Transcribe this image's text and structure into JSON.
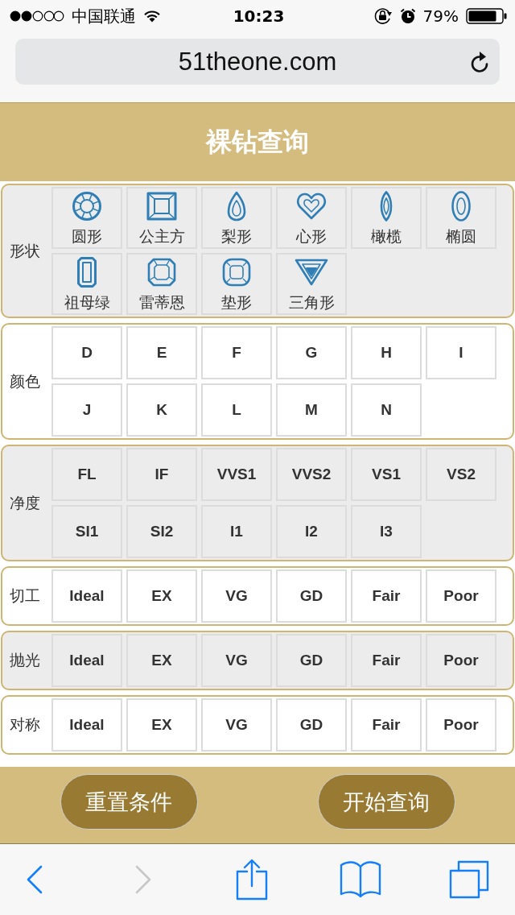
{
  "status_bar": {
    "carrier": "中国联通",
    "time": "10:23",
    "battery": "79%"
  },
  "address_bar": {
    "url": "51theone.com"
  },
  "header": {
    "title": "裸钻查询"
  },
  "filters": [
    {
      "label": "形状",
      "kind": "shape",
      "options": [
        {
          "label": "圆形",
          "kind": "round",
          "selected": false
        },
        {
          "label": "公主方",
          "kind": "square",
          "selected": false
        },
        {
          "label": "梨形",
          "kind": "pear",
          "selected": false
        },
        {
          "label": "心形",
          "kind": "heart",
          "selected": false
        },
        {
          "label": "橄榄",
          "kind": "marquise",
          "selected": false
        },
        {
          "label": "椭圆",
          "kind": "oval",
          "selected": false
        },
        {
          "label": "祖母绿",
          "kind": "emerald",
          "selected": false
        },
        {
          "label": "雷蒂恩",
          "kind": "radiant",
          "selected": false
        },
        {
          "label": "垫形",
          "kind": "cushion",
          "selected": false
        },
        {
          "label": "三角形",
          "kind": "triangle",
          "selected": false
        }
      ]
    },
    {
      "label": "颜色",
      "kind": "grade",
      "options": [
        {
          "label": "D",
          "selected": false
        },
        {
          "label": "E",
          "selected": false
        },
        {
          "label": "F",
          "selected": false
        },
        {
          "label": "G",
          "selected": false
        },
        {
          "label": "H",
          "selected": false
        },
        {
          "label": "I",
          "selected": false
        },
        {
          "label": "J",
          "selected": false
        },
        {
          "label": "K",
          "selected": false
        },
        {
          "label": "L",
          "selected": false
        },
        {
          "label": "M",
          "selected": false
        },
        {
          "label": "N",
          "selected": false
        }
      ]
    },
    {
      "label": "净度",
      "kind": "grade",
      "options": [
        {
          "label": "FL",
          "selected": false
        },
        {
          "label": "IF",
          "selected": false
        },
        {
          "label": "VVS1",
          "selected": false
        },
        {
          "label": "VVS2",
          "selected": false
        },
        {
          "label": "VS1",
          "selected": false
        },
        {
          "label": "VS2",
          "selected": false
        },
        {
          "label": "SI1",
          "selected": false
        },
        {
          "label": "SI2",
          "selected": false
        },
        {
          "label": "I1",
          "selected": false
        },
        {
          "label": "I2",
          "selected": false
        },
        {
          "label": "I3",
          "selected": false
        }
      ]
    },
    {
      "label": "切工",
      "kind": "grade",
      "options": [
        {
          "label": "Ideal",
          "selected": false
        },
        {
          "label": "EX",
          "selected": false
        },
        {
          "label": "VG",
          "selected": false
        },
        {
          "label": "GD",
          "selected": false
        },
        {
          "label": "Fair",
          "selected": false
        },
        {
          "label": "Poor",
          "selected": false
        }
      ]
    },
    {
      "label": "抛光",
      "kind": "grade",
      "options": [
        {
          "label": "Ideal",
          "selected": false
        },
        {
          "label": "EX",
          "selected": false
        },
        {
          "label": "VG",
          "selected": false
        },
        {
          "label": "GD",
          "selected": false
        },
        {
          "label": "Fair",
          "selected": false
        },
        {
          "label": "Poor",
          "selected": false
        }
      ]
    },
    {
      "label": "对称",
      "kind": "grade",
      "options": [
        {
          "label": "Ideal",
          "selected": false
        },
        {
          "label": "EX",
          "selected": false
        },
        {
          "label": "VG",
          "selected": false
        },
        {
          "label": "GD",
          "selected": false
        },
        {
          "label": "Fair",
          "selected": false
        },
        {
          "label": "Poor",
          "selected": false
        }
      ]
    }
  ],
  "actions": [
    {
      "label": "重置条件"
    },
    {
      "label": "开始查询"
    }
  ],
  "toolbar": [
    {
      "kind": "back",
      "disabled": false
    },
    {
      "kind": "forward",
      "disabled": true
    },
    {
      "kind": "share",
      "disabled": false
    },
    {
      "kind": "bookmarks",
      "disabled": false
    },
    {
      "kind": "tabs",
      "disabled": false
    }
  ]
}
